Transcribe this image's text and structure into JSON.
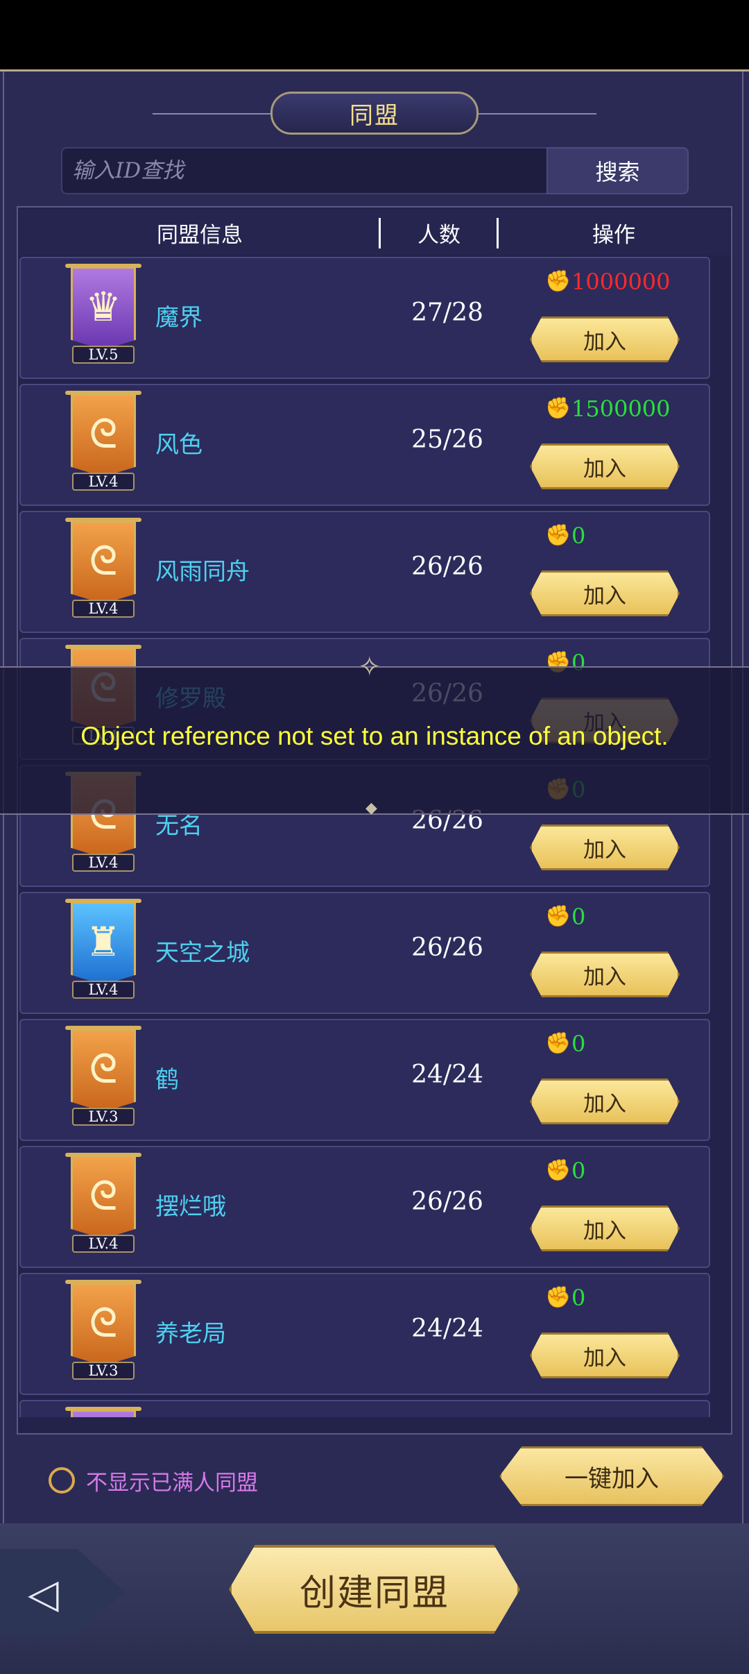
{
  "title": "同盟",
  "search": {
    "placeholder": "输入ID查找",
    "button": "搜索"
  },
  "columns": {
    "info": "同盟信息",
    "members": "人数",
    "action": "操作"
  },
  "alliances": [
    {
      "name": "魔界",
      "level": "LV.5",
      "members": "27/28",
      "power": "1000000",
      "power_color": "#ff2a2a",
      "emblem": "purple",
      "emblem_icon": "crest-icon",
      "join": "加入"
    },
    {
      "name": "风色",
      "level": "LV.4",
      "members": "25/26",
      "power": "1500000",
      "power_color": "#29e03a",
      "emblem": "orange",
      "emblem_icon": "dragon-icon",
      "join": "加入"
    },
    {
      "name": "风雨同舟",
      "level": "LV.4",
      "members": "26/26",
      "power": "0",
      "power_color": "#29e03a",
      "emblem": "orange",
      "emblem_icon": "dragon-icon",
      "join": "加入"
    },
    {
      "name": "修罗殿",
      "level": "LV.4",
      "members": "26/26",
      "power": "0",
      "power_color": "#29e03a",
      "emblem": "orange",
      "emblem_icon": "dragon-icon",
      "join": "加入"
    },
    {
      "name": "无名",
      "level": "LV.4",
      "members": "26/26",
      "power": "0",
      "power_color": "#29e03a",
      "emblem": "orange",
      "emblem_icon": "dragon-icon",
      "join": "加入"
    },
    {
      "name": "天空之城",
      "level": "LV.4",
      "members": "26/26",
      "power": "0",
      "power_color": "#29e03a",
      "emblem": "blue",
      "emblem_icon": "tower-icon",
      "join": "加入"
    },
    {
      "name": "鹤",
      "level": "LV.3",
      "members": "24/24",
      "power": "0",
      "power_color": "#29e03a",
      "emblem": "orange",
      "emblem_icon": "dragon-icon",
      "join": "加入"
    },
    {
      "name": "摆烂哦",
      "level": "LV.4",
      "members": "26/26",
      "power": "0",
      "power_color": "#29e03a",
      "emblem": "orange",
      "emblem_icon": "dragon-icon",
      "join": "加入"
    },
    {
      "name": "养老局",
      "level": "LV.3",
      "members": "24/24",
      "power": "0",
      "power_color": "#29e03a",
      "emblem": "orange",
      "emblem_icon": "dragon-icon",
      "join": "加入"
    }
  ],
  "partial_row": {
    "emblem": "purple"
  },
  "toast": "Object reference not set to an instance of an object.",
  "filter": {
    "label": "不显示已满人同盟",
    "checked": false
  },
  "one_key_join": "一键加入",
  "create": "创建同盟",
  "icons": {
    "power": "fist-icon",
    "back": "back-arrow-icon"
  }
}
